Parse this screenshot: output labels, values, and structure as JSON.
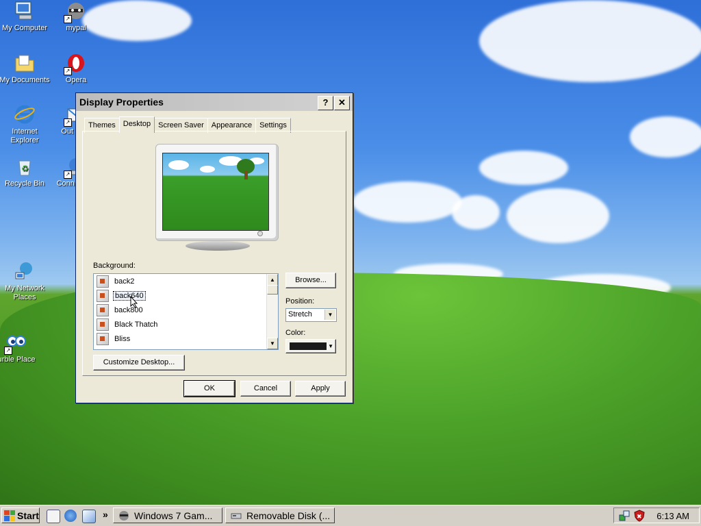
{
  "desktop": {
    "icons": [
      {
        "label": "My Computer",
        "icon": "my-computer-icon"
      },
      {
        "label": "mypal",
        "icon": "mypal-raccoon-icon"
      },
      {
        "label": "My Documents",
        "icon": "my-documents-icon"
      },
      {
        "label": "Opera",
        "icon": "opera-icon"
      },
      {
        "label": "Internet Explorer",
        "icon": "internet-explorer-icon"
      },
      {
        "label": "Out Expr",
        "icon": "outlook-express-icon"
      },
      {
        "label": "Recycle Bin",
        "icon": "recycle-bin-icon"
      },
      {
        "label": "Conn the In",
        "icon": "connect-internet-icon"
      },
      {
        "label": "My Network Places",
        "icon": "network-places-icon"
      },
      {
        "label": "urble Place",
        "icon": "purble-place-icon"
      }
    ]
  },
  "dialog": {
    "title": "Display Properties",
    "help_button": "?",
    "close_button": "✕",
    "tabs": [
      {
        "label": "Themes",
        "active": false
      },
      {
        "label": "Desktop",
        "active": true
      },
      {
        "label": "Screen Saver",
        "active": false
      },
      {
        "label": "Appearance",
        "active": false
      },
      {
        "label": "Settings",
        "active": false
      }
    ],
    "background_label": "Background:",
    "background_items": [
      {
        "label": "back2",
        "icon": "image-file-icon",
        "selected": false
      },
      {
        "label": "back640",
        "icon": "image-file-icon",
        "selected": true
      },
      {
        "label": "back800",
        "icon": "image-file-icon",
        "selected": false
      },
      {
        "label": "Black Thatch",
        "icon": "image-file-icon",
        "selected": false
      },
      {
        "label": "Bliss",
        "icon": "image-file-icon",
        "selected": false
      }
    ],
    "browse_button": "Browse...",
    "position_label": "Position:",
    "position_value": "Stretch",
    "color_label": "Color:",
    "color_value": "#1a1a1a",
    "customize_button": "Customize Desktop...",
    "ok_button": "OK",
    "cancel_button": "Cancel",
    "apply_button": "Apply"
  },
  "taskbar": {
    "start_label": "Start",
    "tasks": [
      {
        "label": "Windows 7 Gam...",
        "icon": "raccoon-icon"
      },
      {
        "label": "Removable Disk (...",
        "icon": "removable-disk-icon"
      }
    ],
    "overflow_glyph": "»",
    "clock": "6:13 AM"
  }
}
